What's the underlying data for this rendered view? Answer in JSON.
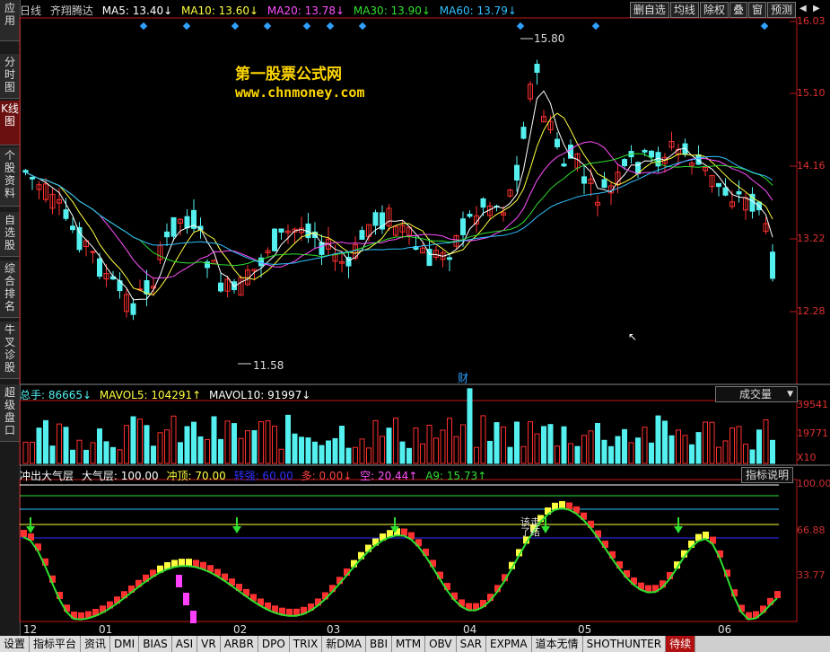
{
  "sidebar": [
    {
      "label": "应用"
    },
    {
      "label": "分时图"
    },
    {
      "label": "K线图"
    },
    {
      "label": "个股资料"
    },
    {
      "label": "自选股"
    },
    {
      "label": "综合排名"
    },
    {
      "label": "牛叉诊股"
    },
    {
      "label": "超级盘口"
    }
  ],
  "header": {
    "period": "日线",
    "stock": "齐翔腾达",
    "ma5": "MA5: 13.40↓",
    "ma10": "MA10: 13.60↓",
    "ma20": "MA20: 13.78↓",
    "ma30": "MA30: 13.90↓",
    "ma60": "MA60: 13.79↓"
  },
  "toolbar": [
    "删自选",
    "均线",
    "除权",
    "叠",
    "窗",
    "预测"
  ],
  "watermark": {
    "title": "第一股票公式网",
    "url": "www.chnmoney.com"
  },
  "price_axis": [
    "16.03",
    "15.10",
    "14.16",
    "13.22",
    "12.28"
  ],
  "price_labels": {
    "high": "15.80",
    "low": "11.58",
    "event": "财"
  },
  "volume": {
    "label": "总手: 86665↓",
    "mavol5": "MAVOL5: 104291↑",
    "mavol10": "MAVOL10: 91997↓",
    "selector": "成交量",
    "axis": [
      "39541",
      "19771",
      "X10"
    ]
  },
  "indicator": {
    "name": "冲出大气层",
    "a": "大气层: 100.00",
    "b": "冲顶: 70.00",
    "c": "转强: 60.00",
    "d": "多: 0.00↓",
    "e": "空: 20.44↑",
    "f": "A9: 15.73↑",
    "button": "指标说明",
    "axis": [
      "100.00",
      "66.88",
      "33.77"
    ],
    "note": "该走了结"
  },
  "months": [
    "12",
    "01",
    "02",
    "03",
    "04",
    "05",
    "06"
  ],
  "tabs": [
    "设置",
    "指标平台",
    "资讯",
    "DMI",
    "BIAS",
    "ASI",
    "VR",
    "ARBR",
    "DPO",
    "TRIX",
    "新DMA",
    "BBI",
    "MTM",
    "OBV",
    "SAR",
    "EXPMA",
    "道本无情",
    "SHOTHUNTER",
    "待续"
  ],
  "colors": {
    "up": "#ff3030",
    "down": "#54f0f0",
    "ma5": "#ffffff",
    "ma10": "#ffff40",
    "ma20": "#ff50ff",
    "ma30": "#30e030",
    "ma60": "#30c0ff",
    "axis": "#c01818"
  }
}
